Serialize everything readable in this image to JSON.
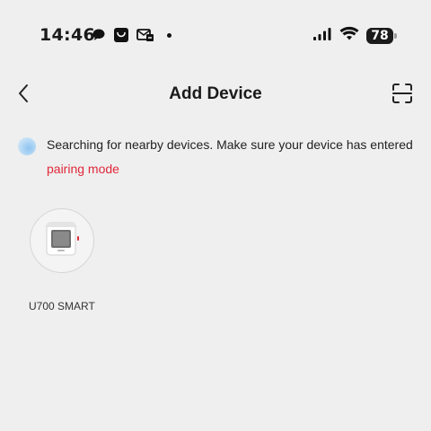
{
  "status_bar": {
    "time": "14:46",
    "notification_icons": [
      "chat-bubble-icon",
      "shopping-bag-icon",
      "mail-icon"
    ],
    "battery": "78"
  },
  "header": {
    "title": "Add Device",
    "back_icon": "chevron-left-icon",
    "scan_icon": "scan-icon"
  },
  "search": {
    "message": "Searching for nearby devices. Make sure your device has entered",
    "link": "pairing mode",
    "link_color": "#e0283a"
  },
  "devices": [
    {
      "name": "U700 SMART"
    }
  ]
}
